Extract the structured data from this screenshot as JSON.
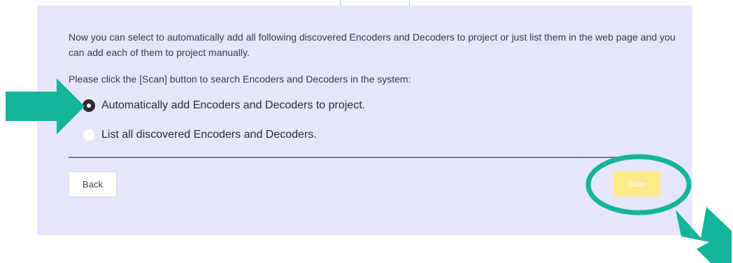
{
  "intro": {
    "text": "Now you can select to automatically add all following discovered Encoders and Decoders to project or just list them in the web page and you can add each of them to project manually."
  },
  "prompt": {
    "text": "Please click the [Scan] button to search Encoders and Decoders in the system:"
  },
  "options": [
    {
      "label": "Automatically add Encoders and Decoders to project.",
      "selected": true
    },
    {
      "label": "List all discovered Encoders and Decoders.",
      "selected": false
    }
  ],
  "buttons": {
    "back_label": "Back",
    "scan_label": "Scan"
  },
  "colors": {
    "panel_background": "#e6e6fa",
    "scan_button": "#fbe98a",
    "annotation_teal": "#14b59a",
    "radio_checked": "#2b2b33"
  },
  "annotations": {
    "arrow_left": "arrow-right-icon",
    "arrow_bottom_right": "arrow-up-left-icon",
    "highlight": "ellipse-highlight"
  }
}
